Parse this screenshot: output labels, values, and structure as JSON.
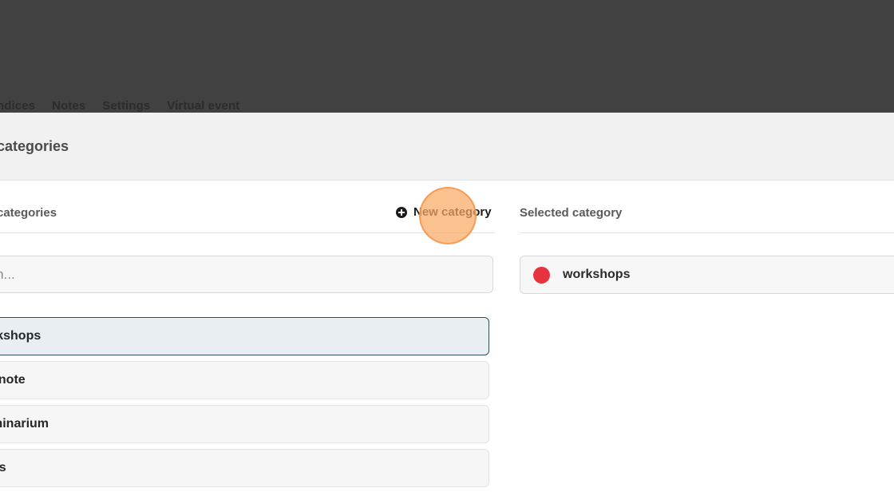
{
  "nav": {
    "tabs": [
      {
        "label": "ndices"
      },
      {
        "label": "Notes"
      },
      {
        "label": "Settings"
      },
      {
        "label": "Virtual event"
      }
    ]
  },
  "panel": {
    "title": "categories"
  },
  "left": {
    "title": "categories",
    "new_category_label": "New category",
    "new_category_icon": "plus-circle-icon",
    "search_placeholder": "rch...",
    "items": [
      {
        "label": "rkshops",
        "active": true
      },
      {
        "label": "ynote",
        "active": false
      },
      {
        "label": "minarium",
        "active": false
      },
      {
        "label": "us",
        "active": false
      }
    ]
  },
  "right": {
    "title": "Selected category",
    "selected": {
      "label": "workshops",
      "color": "#e5343d"
    }
  },
  "colors": {
    "topbar": "#414141",
    "active_border": "#2d5060",
    "click_highlight": "#f9a865"
  }
}
